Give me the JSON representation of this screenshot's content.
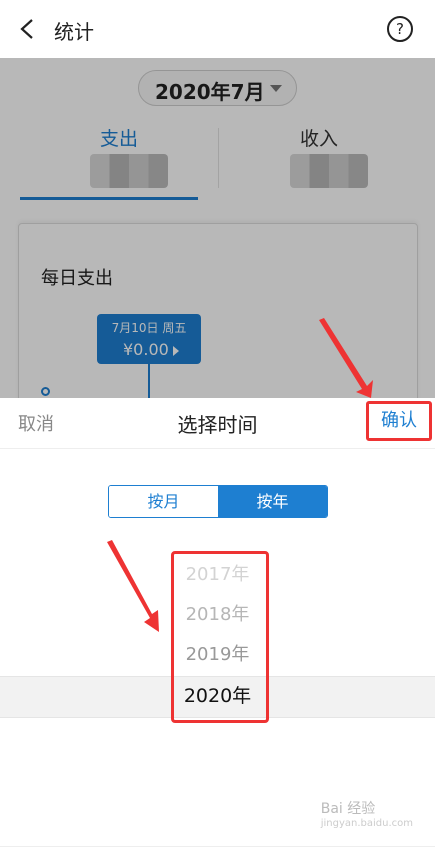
{
  "header": {
    "title": "统计",
    "help_icon_glyph": "?"
  },
  "month_selector": {
    "value": "2020年7月"
  },
  "tabs": [
    {
      "label": "支出",
      "active": true
    },
    {
      "label": "收入",
      "active": false
    }
  ],
  "card": {
    "title": "每日支出",
    "tooltip": {
      "date": "7月10日 周五",
      "amount": "¥0.00"
    }
  },
  "picker": {
    "cancel_label": "取消",
    "title": "选择时间",
    "confirm_label": "确认",
    "mode_options": [
      "按月",
      "按年"
    ],
    "selected_mode": "按年",
    "years": [
      "2017年",
      "2018年",
      "2019年",
      "2020年"
    ],
    "selected_year": "2020年"
  },
  "watermark": {
    "text": "Bai 经验",
    "sub": "jingyan.baidu.com"
  },
  "colors": {
    "accent": "#1e7fd1",
    "highlight": "#e33333"
  }
}
